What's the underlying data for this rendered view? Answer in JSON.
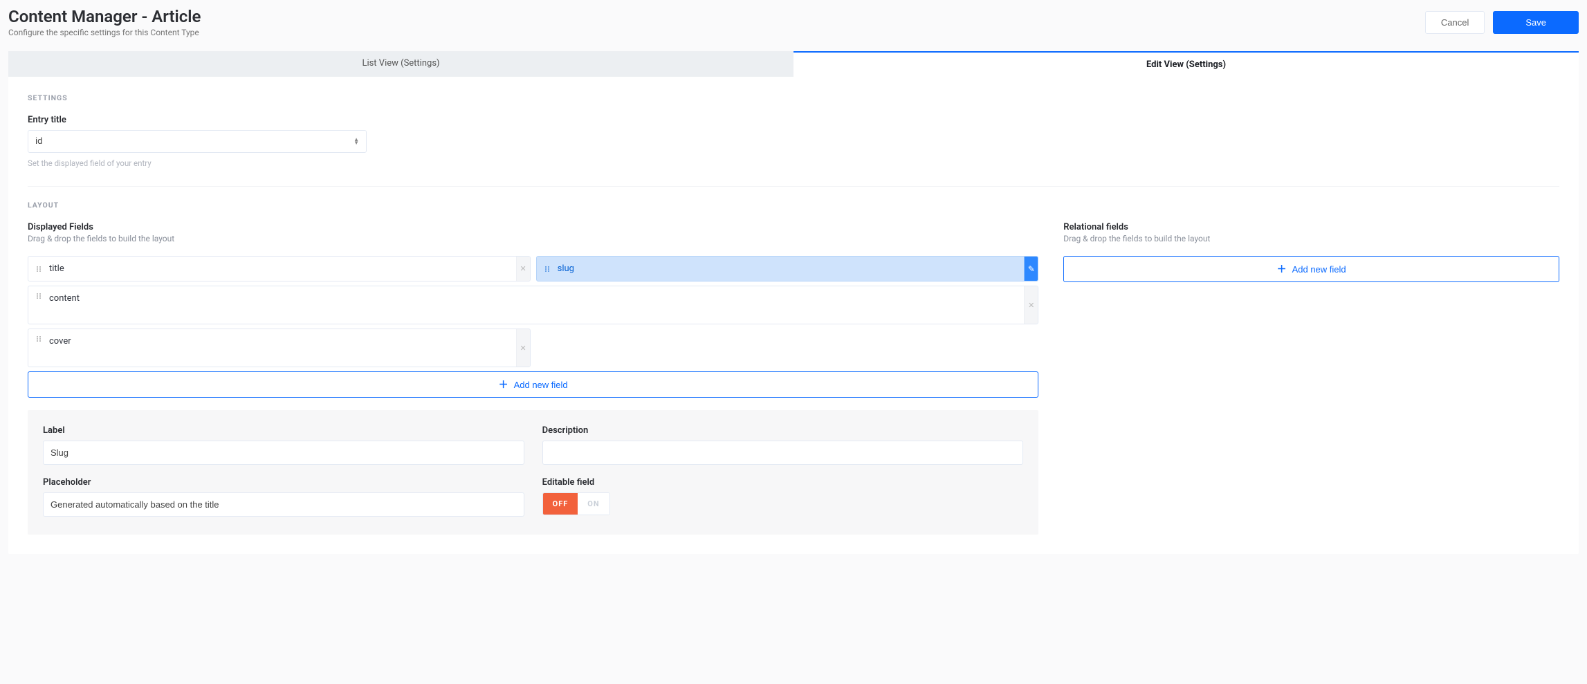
{
  "header": {
    "title": "Content Manager - Article",
    "subtitle": "Configure the specific settings for this Content Type",
    "cancel": "Cancel",
    "save": "Save"
  },
  "tabs": {
    "list_view": "List View (Settings)",
    "edit_view": "Edit View (Settings)"
  },
  "settings": {
    "heading": "SETTINGS",
    "entry_title_label": "Entry title",
    "entry_title_value": "id",
    "entry_title_hint": "Set the displayed field of your entry"
  },
  "layout": {
    "heading": "LAYOUT",
    "displayed_label": "Displayed Fields",
    "displayed_hint": "Drag & drop the fields to build the layout",
    "relational_label": "Relational fields",
    "relational_hint": "Drag & drop the fields to build the layout",
    "add_field": "Add new field",
    "fields": {
      "title": "title",
      "slug": "slug",
      "content": "content",
      "cover": "cover"
    }
  },
  "editor": {
    "label_label": "Label",
    "label_value": "Slug",
    "description_label": "Description",
    "description_value": "",
    "placeholder_label": "Placeholder",
    "placeholder_value": "Generated automatically based on the title",
    "editable_label": "Editable field",
    "toggle_off": "OFF",
    "toggle_on": "ON"
  }
}
